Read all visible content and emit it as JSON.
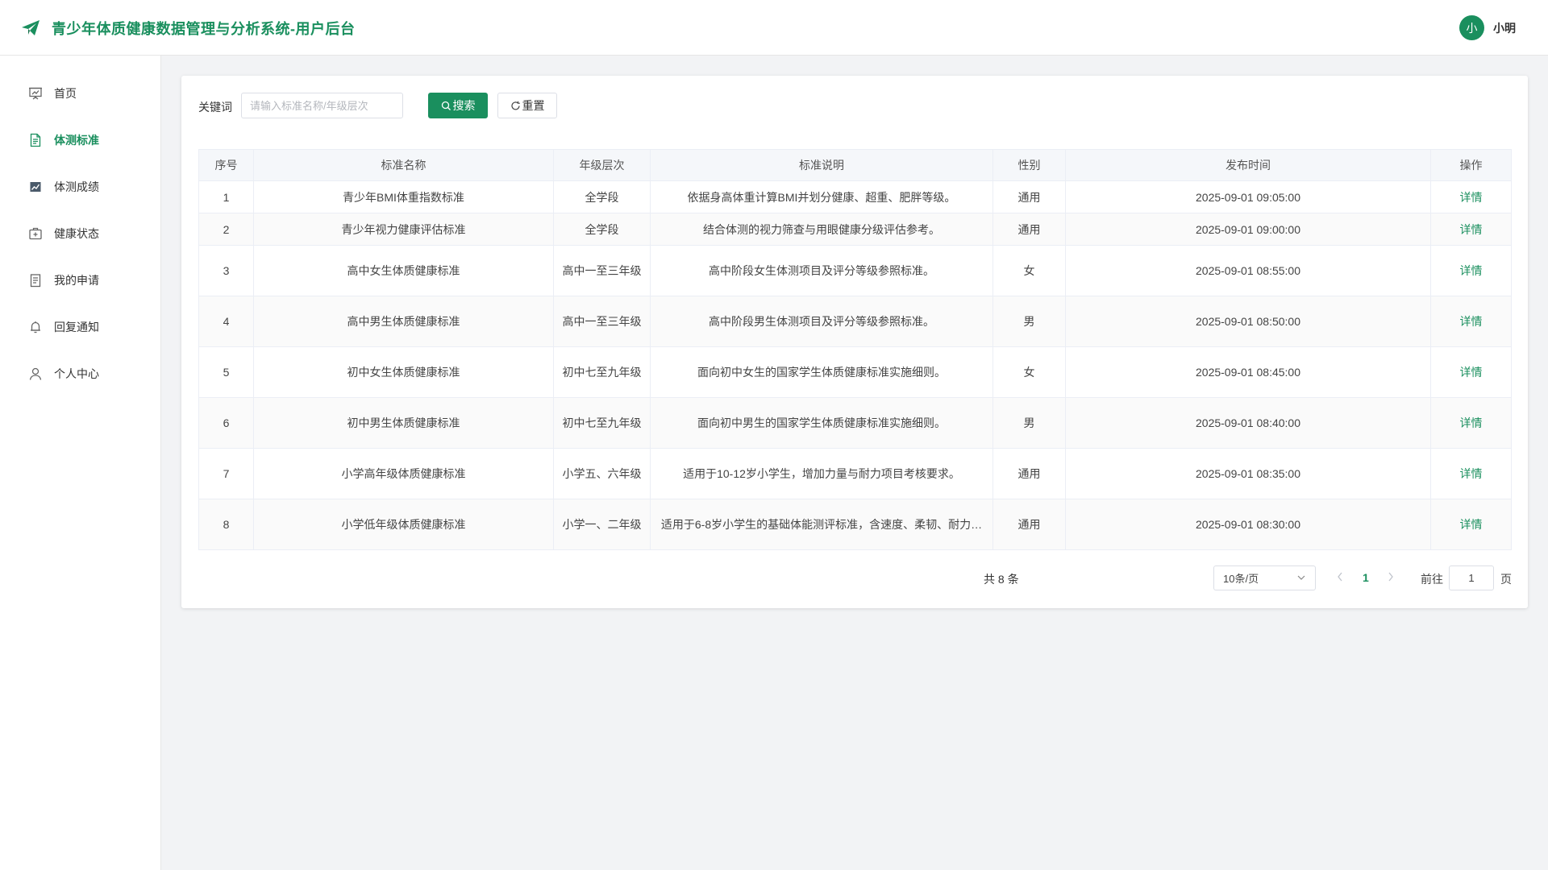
{
  "header": {
    "app_title": "青少年体质健康数据管理与分析系统-用户后台",
    "user": {
      "avatar_text": "小",
      "name": "小明"
    }
  },
  "sidebar": {
    "items": [
      {
        "label": "首页",
        "icon": "presentation-icon",
        "active": false
      },
      {
        "label": "体测标准",
        "icon": "document-icon",
        "active": true
      },
      {
        "label": "体测成绩",
        "icon": "chart-icon",
        "active": false
      },
      {
        "label": "健康状态",
        "icon": "first-aid-icon",
        "active": false
      },
      {
        "label": "我的申请",
        "icon": "clipboard-icon",
        "active": false
      },
      {
        "label": "回复通知",
        "icon": "bell-icon",
        "active": false
      },
      {
        "label": "个人中心",
        "icon": "user-icon",
        "active": false
      }
    ]
  },
  "search": {
    "label": "关键词",
    "placeholder": "请输入标准名称/年级层次",
    "value": "",
    "search_button": "搜索",
    "reset_button": "重置"
  },
  "table": {
    "headers": [
      "序号",
      "标准名称",
      "年级层次",
      "标准说明",
      "性别",
      "发布时间",
      "操作"
    ],
    "rows": [
      {
        "no": "1",
        "name": "青少年BMI体重指数标准",
        "grade": "全学段",
        "desc": "依据身高体重计算BMI并划分健康、超重、肥胖等级。",
        "gender": "通用",
        "time": "2025-09-01 09:05:00",
        "action": "详情"
      },
      {
        "no": "2",
        "name": "青少年视力健康评估标准",
        "grade": "全学段",
        "desc": "结合体测的视力筛查与用眼健康分级评估参考。",
        "gender": "通用",
        "time": "2025-09-01 09:00:00",
        "action": "详情"
      },
      {
        "no": "3",
        "name": "高中女生体质健康标准",
        "grade": "高中一至三年级",
        "desc": "高中阶段女生体测项目及评分等级参照标准。",
        "gender": "女",
        "time": "2025-09-01 08:55:00",
        "action": "详情"
      },
      {
        "no": "4",
        "name": "高中男生体质健康标准",
        "grade": "高中一至三年级",
        "desc": "高中阶段男生体测项目及评分等级参照标准。",
        "gender": "男",
        "time": "2025-09-01 08:50:00",
        "action": "详情"
      },
      {
        "no": "5",
        "name": "初中女生体质健康标准",
        "grade": "初中七至九年级",
        "desc": "面向初中女生的国家学生体质健康标准实施细则。",
        "gender": "女",
        "time": "2025-09-01 08:45:00",
        "action": "详情"
      },
      {
        "no": "6",
        "name": "初中男生体质健康标准",
        "grade": "初中七至九年级",
        "desc": "面向初中男生的国家学生体质健康标准实施细则。",
        "gender": "男",
        "time": "2025-09-01 08:40:00",
        "action": "详情"
      },
      {
        "no": "7",
        "name": "小学高年级体质健康标准",
        "grade": "小学五、六年级",
        "desc": "适用于10-12岁小学生，增加力量与耐力项目考核要求。",
        "gender": "通用",
        "time": "2025-09-01 08:35:00",
        "action": "详情"
      },
      {
        "no": "8",
        "name": "小学低年级体质健康标准",
        "grade": "小学一、二年级",
        "desc": "适用于6-8岁小学生的基础体能测评标准，含速度、柔韧、耐力…",
        "gender": "通用",
        "time": "2025-09-01 08:30:00",
        "action": "详情"
      }
    ]
  },
  "pagination": {
    "total_text": "共 8 条",
    "page_size": "10条/页",
    "current_page": "1",
    "goto_label": "前往",
    "goto_value": "1",
    "goto_suffix": "页"
  },
  "colors": {
    "accent": "#1a8f5e"
  }
}
